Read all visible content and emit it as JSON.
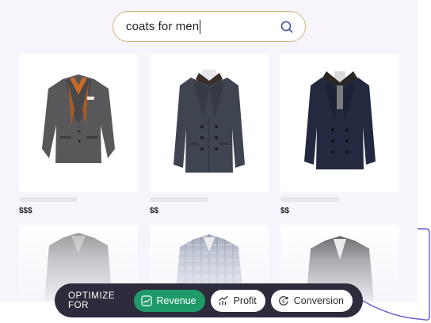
{
  "search": {
    "query": "coats for men",
    "icon": "search-icon"
  },
  "products": [
    {
      "price": "$$$",
      "icon": "gray-blazer-image"
    },
    {
      "price": "$$",
      "icon": "charcoal-peacoat-image"
    },
    {
      "price": "$$",
      "icon": "navy-fur-collar-coat-image"
    }
  ],
  "products_row2": [
    {
      "icon": "gray-blazer-image"
    },
    {
      "icon": "plaid-blazer-image"
    },
    {
      "icon": "dark-blazer-image"
    }
  ],
  "optimize": {
    "label": "OPTIMIZE FOR",
    "options": [
      {
        "label": "Revenue",
        "active": true,
        "icon": "revenue-chart-icon"
      },
      {
        "label": "Profit",
        "active": false,
        "icon": "profit-chart-icon"
      },
      {
        "label": "Conversion",
        "active": false,
        "icon": "conversion-icon"
      }
    ]
  },
  "colors": {
    "accent_green": "#1e9a68",
    "bar_dark": "#2d2b3c",
    "search_border": "#c9b57a",
    "connector": "#6a5acd"
  }
}
